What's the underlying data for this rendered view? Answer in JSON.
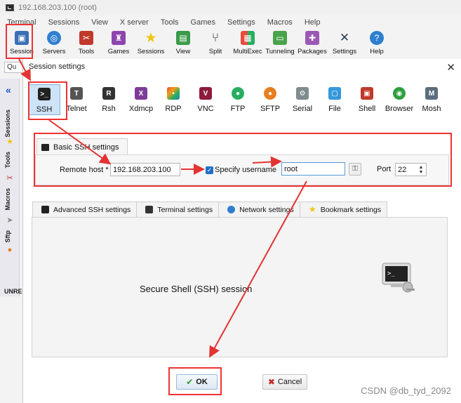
{
  "window": {
    "title": "192.168.203.100 (root)"
  },
  "menubar": [
    "Terminal",
    "Sessions",
    "View",
    "X server",
    "Tools",
    "Games",
    "Settings",
    "Macros",
    "Help"
  ],
  "toolbar": [
    {
      "label": "Session",
      "icon": "session-icon"
    },
    {
      "label": "Servers",
      "icon": "servers-icon"
    },
    {
      "label": "Tools",
      "icon": "tools-icon"
    },
    {
      "label": "Games",
      "icon": "games-icon"
    },
    {
      "label": "Sessions",
      "icon": "star-icon"
    },
    {
      "label": "View",
      "icon": "view-icon"
    },
    {
      "label": "Split",
      "icon": "split-icon"
    },
    {
      "label": "MultiExec",
      "icon": "multiexec-icon"
    },
    {
      "label": "Tunneling",
      "icon": "tunneling-icon"
    },
    {
      "label": "Packages",
      "icon": "packages-icon"
    },
    {
      "label": "Settings",
      "icon": "settings-icon"
    },
    {
      "label": "Help",
      "icon": "help-icon"
    }
  ],
  "quickconnect": {
    "text": "Qu"
  },
  "sidebar": {
    "tabs": [
      "Sessions",
      "Tools",
      "Macros",
      "Sftp"
    ],
    "status": "UNRE"
  },
  "dialog": {
    "title": "Session settings",
    "session_types": [
      "SSH",
      "Telnet",
      "Rsh",
      "Xdmcp",
      "RDP",
      "VNC",
      "FTP",
      "SFTP",
      "Serial",
      "File",
      "Shell",
      "Browser",
      "Mosh"
    ],
    "basic_tab": "Basic SSH settings",
    "remote_host_label": "Remote host *",
    "remote_host_value": "192.168.203.100",
    "specify_username_label": "Specify username",
    "username_value": "root",
    "port_label": "Port",
    "port_value": "22",
    "lower_tabs": [
      "Advanced SSH settings",
      "Terminal settings",
      "Network settings",
      "Bookmark settings"
    ],
    "description": "Secure Shell (SSH) session",
    "ok_label": "OK",
    "cancel_label": "Cancel"
  },
  "watermark": "CSDN @db_tyd_2092",
  "colors": {
    "annotation": "#e33333",
    "accent": "#1f6fc8"
  }
}
